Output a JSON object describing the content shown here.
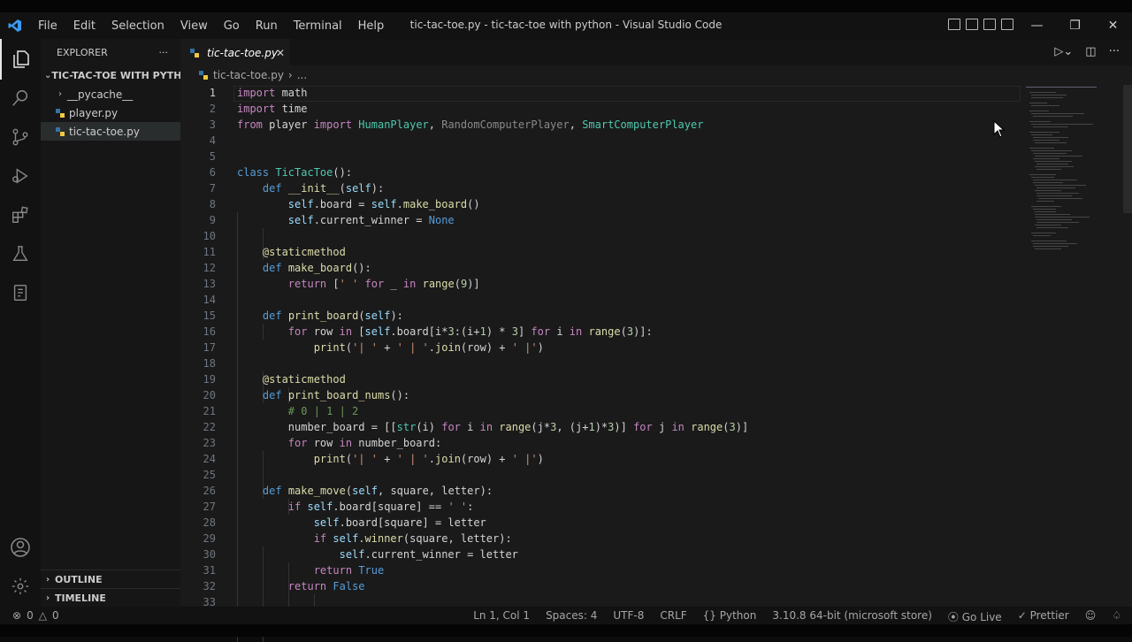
{
  "window": {
    "title": "tic-tac-toe.py - tic-tac-toe with python - Visual Studio Code",
    "menu": [
      "File",
      "Edit",
      "Selection",
      "View",
      "Go",
      "Run",
      "Terminal",
      "Help"
    ]
  },
  "sidebar": {
    "header": "EXPLORER",
    "more": "···",
    "project": "TIC-TAC-TOE WITH PYTHON",
    "items": [
      {
        "label": "__pycache__",
        "type": "folder"
      },
      {
        "label": "player.py",
        "type": "python"
      },
      {
        "label": "tic-tac-toe.py",
        "type": "python",
        "selected": true
      }
    ],
    "outline": "OUTLINE",
    "timeline": "TIMELINE"
  },
  "editor": {
    "tab": "tic-tac-toe.py",
    "breadcrumb": [
      "tic-tac-toe.py",
      "..."
    ],
    "line_numbers": [
      "1",
      "2",
      "3",
      "4",
      "5",
      "6",
      "7",
      "8",
      "9",
      "10",
      "11",
      "12",
      "13",
      "14",
      "15",
      "16",
      "17",
      "18",
      "19",
      "20",
      "21",
      "22",
      "23",
      "24",
      "25",
      "26",
      "27",
      "28",
      "29",
      "30",
      "31",
      "32",
      "33"
    ]
  },
  "status": {
    "errors": "0",
    "warnings": "0",
    "position": "Ln 1, Col 1",
    "spaces": "Spaces: 4",
    "encoding": "UTF-8",
    "eol": "CRLF",
    "language": "Python",
    "interpreter": "3.10.8 64-bit (microsoft store)",
    "golive": "Go Live",
    "prettier": "Prettier"
  },
  "colors": {
    "keyword": "#c586c0",
    "class": "#4ec9b0",
    "function": "#dcdcaa",
    "string": "#ce9178",
    "comment": "#6a9955",
    "variable": "#9cdcfe",
    "number": "#b5cea8",
    "accent": "#3c9bf0"
  }
}
